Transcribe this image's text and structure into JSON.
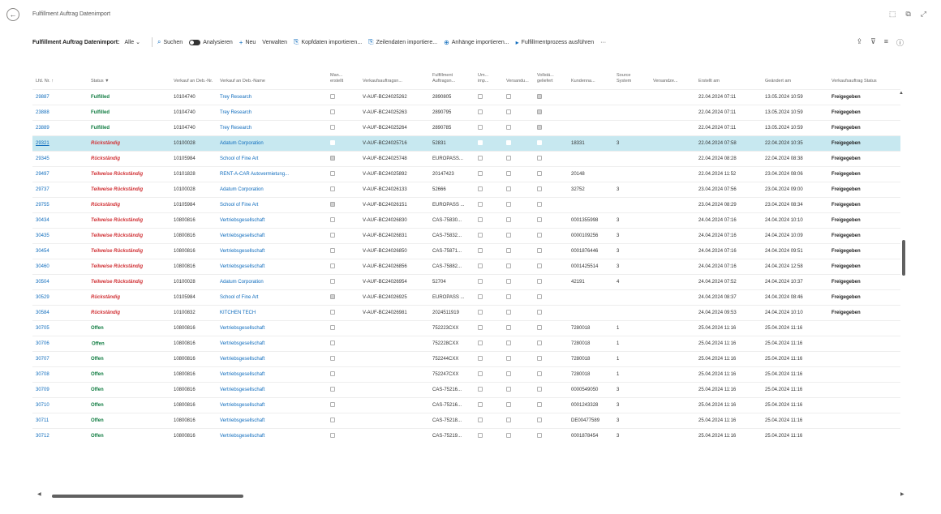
{
  "page": {
    "title": "Fulfillment Auftrag Datenimport",
    "back_icon": "arrow-left-icon"
  },
  "actionbar": {
    "title": "Fulfillment Auftrag Datenimport:",
    "filter": "Alle",
    "search": "Suchen",
    "analyze": "Analysieren",
    "new": "Neu",
    "manage": "Verwalten",
    "import_heads": "Kopfdaten importieren...",
    "import_lines": "Zeilendaten importiere...",
    "import_attachments": "Anhänge importieren...",
    "run_process": "Fulfillmentprozess ausführen",
    "more": "···"
  },
  "columns": [
    "Lfd. Nr. ↑",
    "Status ▼",
    "Verkauf an Deb.-Nr.",
    "Verkauf an Deb.-Name",
    "Man... erstellt",
    "Verkaufsauftragsn...",
    "Fulfillment Auftragsn...",
    "Um... imp...",
    "Versandu...",
    "Vollstä... geliefert",
    "Kundenna...",
    "Source System",
    "Versandze...",
    "Erstellt am",
    "Geändert am",
    "Verkaufsauftrag Status"
  ],
  "rows": [
    {
      "nr": "29887",
      "status": "Fulfilled",
      "deb_nr": "10104740",
      "deb_name": "Trey Research",
      "man": false,
      "va_nr": "V-AUF-BC24025262",
      "ff_nr": "2890805",
      "um": false,
      "vs": false,
      "voll": true,
      "kunde": "",
      "src": "",
      "vz": "",
      "created": "22.04.2024 07:11",
      "changed": "13.05.2024 10:59",
      "va_status": "Freigegeben"
    },
    {
      "nr": "23888",
      "status": "Fulfilled",
      "deb_nr": "10104740",
      "deb_name": "Trey Research",
      "man": false,
      "va_nr": "V-AUF-BC24025263",
      "ff_nr": "2890795",
      "um": false,
      "vs": false,
      "voll": true,
      "kunde": "",
      "src": "",
      "vz": "",
      "created": "22.04.2024 07:11",
      "changed": "13.05.2024 10:59",
      "va_status": "Freigegeben"
    },
    {
      "nr": "23889",
      "status": "Fulfilled",
      "deb_nr": "10104740",
      "deb_name": "Trey Research",
      "man": false,
      "va_nr": "V-AUF-BC24025264",
      "ff_nr": "2890785",
      "um": false,
      "vs": false,
      "voll": true,
      "kunde": "",
      "src": "",
      "vz": "",
      "created": "22.04.2024 07:11",
      "changed": "13.05.2024 10:59",
      "va_status": "Freigegeben"
    },
    {
      "nr": "29321",
      "status": "Rückständig",
      "deb_nr": "10100028",
      "deb_name": "Adatum Corporation",
      "man": false,
      "va_nr": "V-AUF-BC24025716",
      "ff_nr": "52831",
      "um": false,
      "vs": false,
      "voll": false,
      "kunde": "18331",
      "src": "3",
      "vz": "",
      "created": "22.04.2024 07:58",
      "changed": "22.04.2024 10:35",
      "va_status": "Freigegeben",
      "selected": true
    },
    {
      "nr": "29345",
      "status": "Rückständig",
      "deb_nr": "10105984",
      "deb_name": "School of Fine Art",
      "man": true,
      "va_nr": "V-AUF-BC24025748",
      "ff_nr": "EUROPASS...",
      "um": false,
      "vs": false,
      "voll": false,
      "kunde": "",
      "src": "",
      "vz": "",
      "created": "22.04.2024 08:28",
      "changed": "22.04.2024 08:38",
      "va_status": "Freigegeben"
    },
    {
      "nr": "29497",
      "status": "Teilweise Rückständig",
      "deb_nr": "10101828",
      "deb_name": "RENT-A-CAR Autovermietung...",
      "man": false,
      "va_nr": "V-AUF-BC24025892",
      "ff_nr": "20147423",
      "um": false,
      "vs": false,
      "voll": false,
      "kunde": "20148",
      "src": "",
      "vz": "",
      "created": "22.04.2024 11:52",
      "changed": "23.04.2024 08:06",
      "va_status": "Freigegeben"
    },
    {
      "nr": "29737",
      "status": "Teilweise Rückständig",
      "deb_nr": "10100028",
      "deb_name": "Adatum Corporation",
      "man": false,
      "va_nr": "V-AUF-BC24026133",
      "ff_nr": "52666",
      "um": false,
      "vs": false,
      "voll": false,
      "kunde": "32752",
      "src": "3",
      "vz": "",
      "created": "23.04.2024 07:56",
      "changed": "23.04.2024 09:00",
      "va_status": "Freigegeben"
    },
    {
      "nr": "29755",
      "status": "Rückständig",
      "deb_nr": "10105984",
      "deb_name": "School of Fine Art",
      "man": true,
      "va_nr": "V-AUF-BC24026151",
      "ff_nr": "EUROPASS ...",
      "um": false,
      "vs": false,
      "voll": false,
      "kunde": "",
      "src": "",
      "vz": "",
      "created": "23.04.2024 08:29",
      "changed": "23.04.2024 08:34",
      "va_status": "Freigegeben"
    },
    {
      "nr": "30434",
      "status": "Teilweise Rückständig",
      "deb_nr": "10800816",
      "deb_name": "Vertriebsgesellschaft",
      "man": false,
      "va_nr": "V-AUF-BC24026830",
      "ff_nr": "CAS-75830...",
      "um": false,
      "vs": false,
      "voll": false,
      "kunde": "0001355998",
      "src": "3",
      "vz": "",
      "created": "24.04.2024 07:16",
      "changed": "24.04.2024 10:10",
      "va_status": "Freigegeben"
    },
    {
      "nr": "30435",
      "status": "Teilweise Rückständig",
      "deb_nr": "10800816",
      "deb_name": "Vertriebsgesellschaft",
      "man": false,
      "va_nr": "V-AUF-BC24026831",
      "ff_nr": "CAS-75832...",
      "um": false,
      "vs": false,
      "voll": false,
      "kunde": "0000109256",
      "src": "3",
      "vz": "",
      "created": "24.04.2024 07:16",
      "changed": "24.04.2024 10:09",
      "va_status": "Freigegeben"
    },
    {
      "nr": "30454",
      "status": "Teilweise Rückständig",
      "deb_nr": "10800816",
      "deb_name": "Vertriebsgesellschaft",
      "man": false,
      "va_nr": "V-AUF-BC24026850",
      "ff_nr": "CAS-75871...",
      "um": false,
      "vs": false,
      "voll": false,
      "kunde": "0001876446",
      "src": "3",
      "vz": "",
      "created": "24.04.2024 07:16",
      "changed": "24.04.2024 09:51",
      "va_status": "Freigegeben"
    },
    {
      "nr": "30460",
      "status": "Teilweise Rückständig",
      "deb_nr": "10800816",
      "deb_name": "Vertriebsgesellschaft",
      "man": false,
      "va_nr": "V-AUF-BC24026856",
      "ff_nr": "CAS-75882...",
      "um": false,
      "vs": false,
      "voll": false,
      "kunde": "0001425514",
      "src": "3",
      "vz": "",
      "created": "24.04.2024 07:16",
      "changed": "24.04.2024 12:58",
      "va_status": "Freigegeben"
    },
    {
      "nr": "30504",
      "status": "Teilweise Rückständig",
      "deb_nr": "10100028",
      "deb_name": "Adatum Corporation",
      "man": false,
      "va_nr": "V-AUF-BC24026954",
      "ff_nr": "52704",
      "um": false,
      "vs": false,
      "voll": false,
      "kunde": "42191",
      "src": "4",
      "vz": "",
      "created": "24.04.2024 07:52",
      "changed": "24.04.2024 10:37",
      "va_status": "Freigegeben"
    },
    {
      "nr": "30529",
      "status": "Rückständig",
      "deb_nr": "10105984",
      "deb_name": "School of Fine Art",
      "man": true,
      "va_nr": "V-AUF-BC24026925",
      "ff_nr": "EUROPASS ...",
      "um": false,
      "vs": false,
      "voll": false,
      "kunde": "",
      "src": "",
      "vz": "",
      "created": "24.04.2024 08:37",
      "changed": "24.04.2024 08:46",
      "va_status": "Freigegeben"
    },
    {
      "nr": "30584",
      "status": "Rückständig",
      "deb_nr": "10100832",
      "deb_name": "KITCHEN TECH",
      "man": false,
      "va_nr": "V-AUF-BC24026981",
      "ff_nr": "2024511919",
      "um": false,
      "vs": false,
      "voll": false,
      "kunde": "",
      "src": "",
      "vz": "",
      "created": "24.04.2024 09:53",
      "changed": "24.04.2024 10:10",
      "va_status": "Freigegeben"
    },
    {
      "nr": "30705",
      "status": "Offen",
      "deb_nr": "10800816",
      "deb_name": "Vertriebsgesellschaft",
      "man": false,
      "va_nr": "",
      "ff_nr": "752223CXX",
      "um": false,
      "vs": false,
      "voll": false,
      "kunde": "7280018",
      "src": "1",
      "vz": "",
      "created": "25.04.2024 11:16",
      "changed": "25.04.2024 11:16",
      "va_status": ""
    },
    {
      "nr": "30706",
      "status": "Offen",
      "deb_nr": "10800816",
      "deb_name": "Vertriebsgesellschaft",
      "man": false,
      "va_nr": "",
      "ff_nr": "752228CXX",
      "um": false,
      "vs": false,
      "voll": false,
      "kunde": "7280018",
      "src": "1",
      "vz": "",
      "created": "25.04.2024 11:16",
      "changed": "25.04.2024 11:16",
      "va_status": "",
      "rowbar": true
    },
    {
      "nr": "30707",
      "status": "Offen",
      "deb_nr": "10800816",
      "deb_name": "Vertriebsgesellschaft",
      "man": false,
      "va_nr": "",
      "ff_nr": "752244CXX",
      "um": false,
      "vs": false,
      "voll": false,
      "kunde": "7280018",
      "src": "1",
      "vz": "",
      "created": "25.04.2024 11:16",
      "changed": "25.04.2024 11:16",
      "va_status": ""
    },
    {
      "nr": "30708",
      "status": "Offen",
      "deb_nr": "10800816",
      "deb_name": "Vertriebsgesellschaft",
      "man": false,
      "va_nr": "",
      "ff_nr": "752247CXX",
      "um": false,
      "vs": false,
      "voll": false,
      "kunde": "7280018",
      "src": "1",
      "vz": "",
      "created": "25.04.2024 11:16",
      "changed": "25.04.2024 11:16",
      "va_status": ""
    },
    {
      "nr": "30709",
      "status": "Offen",
      "deb_nr": "10800816",
      "deb_name": "Vertriebsgesellschaft",
      "man": false,
      "va_nr": "",
      "ff_nr": "CAS-75216...",
      "um": false,
      "vs": false,
      "voll": false,
      "kunde": "0000549050",
      "src": "3",
      "vz": "",
      "created": "25.04.2024 11:16",
      "changed": "25.04.2024 11:16",
      "va_status": ""
    },
    {
      "nr": "30710",
      "status": "Offen",
      "deb_nr": "10800816",
      "deb_name": "Vertriebsgesellschaft",
      "man": false,
      "va_nr": "",
      "ff_nr": "CAS-75216...",
      "um": false,
      "vs": false,
      "voll": false,
      "kunde": "0001243328",
      "src": "3",
      "vz": "",
      "created": "25.04.2024 11:16",
      "changed": "25.04.2024 11:16",
      "va_status": ""
    },
    {
      "nr": "30711",
      "status": "Offen",
      "deb_nr": "10800816",
      "deb_name": "Vertriebsgesellschaft",
      "man": false,
      "va_nr": "",
      "ff_nr": "CAS-75218...",
      "um": false,
      "vs": false,
      "voll": false,
      "kunde": "DE00477589",
      "src": "3",
      "vz": "",
      "created": "25.04.2024 11:16",
      "changed": "25.04.2024 11:16",
      "va_status": ""
    },
    {
      "nr": "30712",
      "status": "Offen",
      "deb_nr": "10800816",
      "deb_name": "Vertriebsgesellschaft",
      "man": false,
      "va_nr": "",
      "ff_nr": "CAS-75219...",
      "um": false,
      "vs": false,
      "voll": false,
      "kunde": "0001878454",
      "src": "3",
      "vz": "",
      "created": "25.04.2024 11:16",
      "changed": "25.04.2024 11:16",
      "va_status": ""
    }
  ]
}
